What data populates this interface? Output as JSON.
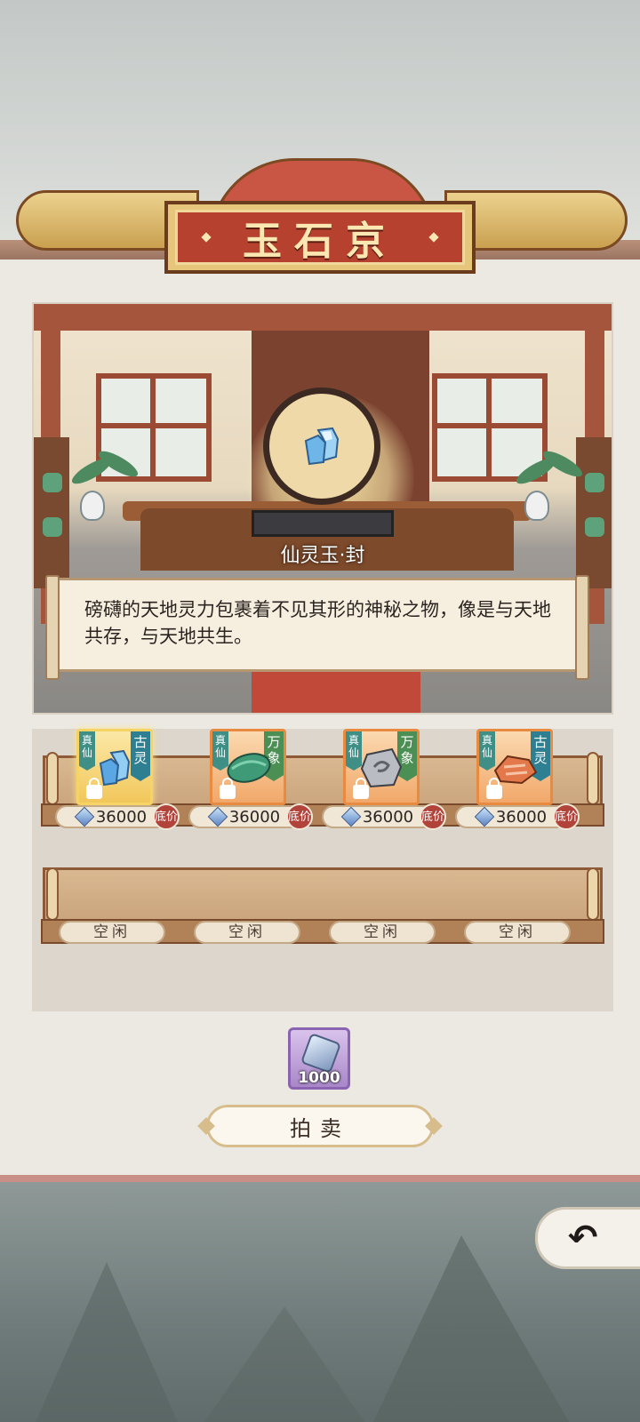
{
  "header": {
    "title": "玉石京"
  },
  "showcase": {
    "item_name": "仙灵玉·封",
    "description": "磅礴的天地灵力包裹着不见其形的神秘之物，像是与天地共存，与天地共生。"
  },
  "shelves": {
    "row1": [
      {
        "realm": "真仙",
        "category": "古灵",
        "price": "36000",
        "floor_label": "底价",
        "item_icon": "blue-crystal-icon",
        "selected": true
      },
      {
        "realm": "真仙",
        "category": "万象",
        "price": "36000",
        "floor_label": "底价",
        "item_icon": "green-jade-icon",
        "selected": false
      },
      {
        "realm": "真仙",
        "category": "万象",
        "price": "36000",
        "floor_label": "底价",
        "item_icon": "gray-stone-icon",
        "selected": false
      },
      {
        "realm": "真仙",
        "category": "古灵",
        "price": "36000",
        "floor_label": "底价",
        "item_icon": "orange-ore-icon",
        "selected": false
      }
    ],
    "row2": [
      {
        "status": "空闲"
      },
      {
        "status": "空闲"
      },
      {
        "status": "空闲"
      },
      {
        "status": "空闲"
      }
    ]
  },
  "cost": {
    "amount": "1000",
    "icon": "spirit-stone-icon"
  },
  "actions": {
    "auction_label": "拍卖",
    "back_icon": "return-arrow-icon"
  },
  "colors": {
    "banner_red": "#b6412f",
    "banner_gold": "#e5c67a",
    "slot_gold": "#f6d365",
    "slot_orange": "#e88b41",
    "tag_teal": "#2f7f92",
    "tag_green": "#4c8f54",
    "floor_badge": "#b1433b",
    "cost_purple": "#a987c9"
  }
}
